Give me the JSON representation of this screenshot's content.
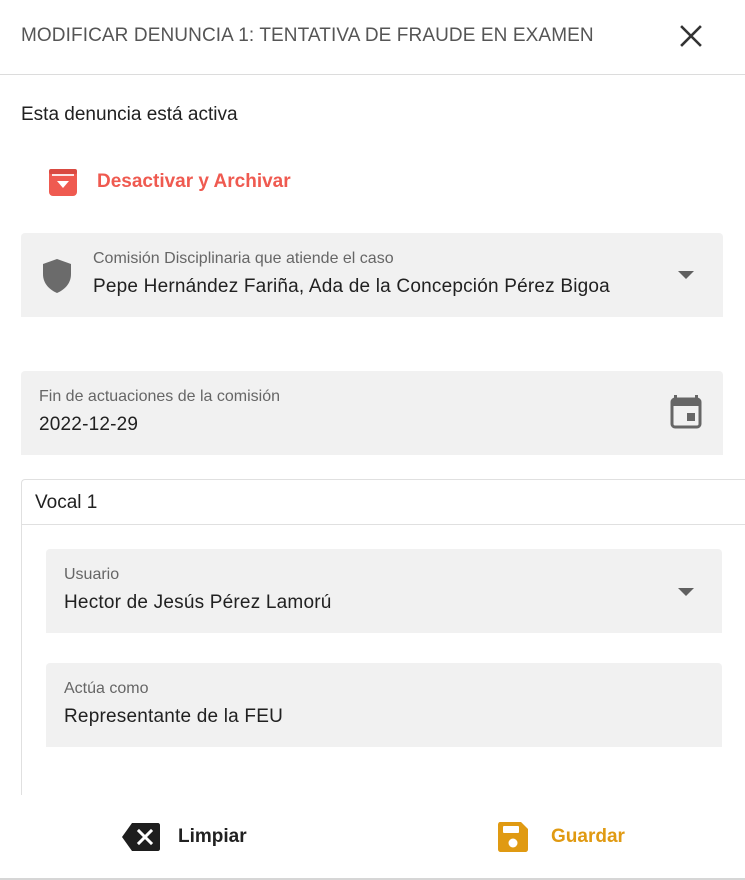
{
  "dialog": {
    "title": "MODIFICAR DENUNCIA 1: TENTATIVA DE FRAUDE EN EXAMEN",
    "close_icon": "close-icon"
  },
  "status": {
    "text": "Esta denuncia está activa",
    "archive_label": "Desactivar y Archivar",
    "archive_icon": "archive-down-icon",
    "archive_color": "#ef5a50"
  },
  "commission": {
    "label": "Comisión Disciplinaria que atiende el caso",
    "value": "Pepe Hernández Fariña, Ada de la Concepción Pérez Bigoa",
    "icon": "shield-icon"
  },
  "deadline": {
    "label": "Fin de actuaciones de la comisión",
    "value": "2022-12-29",
    "icon": "calendar-icon"
  },
  "vocal": {
    "title": "Vocal 1",
    "user_label": "Usuario",
    "user_value": "Hector de Jesús Pérez Lamorú",
    "role_label": "Actúa como",
    "role_value": "Representante de la FEU"
  },
  "footer": {
    "clear_label": "Limpiar",
    "clear_icon": "backspace-icon",
    "save_label": "Guardar",
    "save_icon": "floppy-icon",
    "save_color": "#e09a12"
  }
}
